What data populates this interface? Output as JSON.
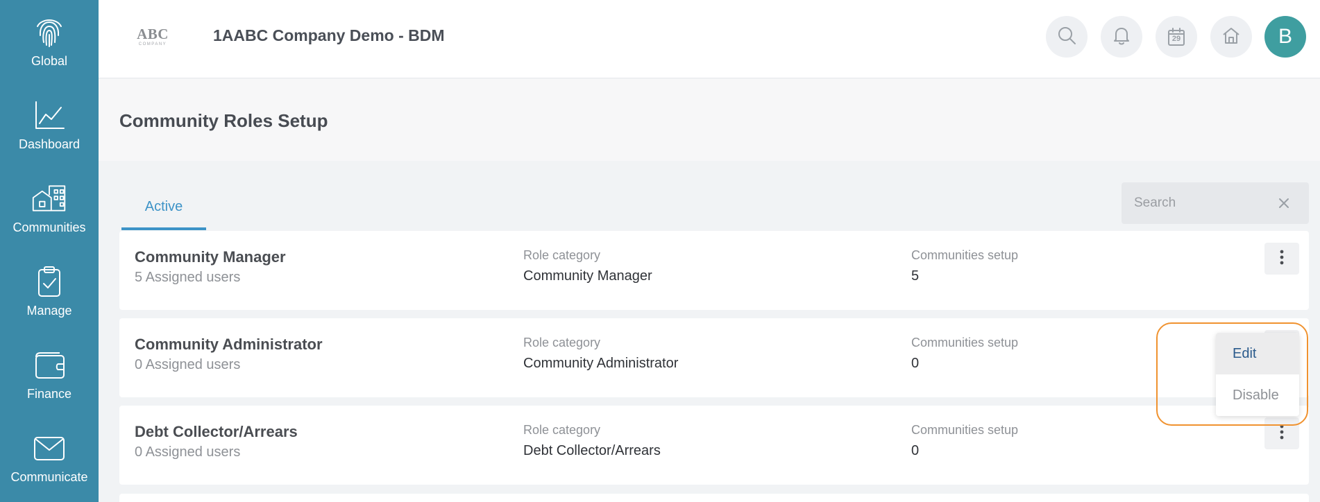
{
  "sidebar": {
    "items": [
      {
        "label": "Global",
        "icon": "fingerprint-icon"
      },
      {
        "label": "Dashboard",
        "icon": "chart-line-icon"
      },
      {
        "label": "Communities",
        "icon": "buildings-icon"
      },
      {
        "label": "Manage",
        "icon": "clipboard-check-icon"
      },
      {
        "label": "Finance",
        "icon": "wallet-icon"
      },
      {
        "label": "Communicate",
        "icon": "envelope-icon"
      }
    ]
  },
  "header": {
    "logo_text": "ABC",
    "logo_subtext": "COMPANY",
    "company_name": "1AABC Company Demo - BDM",
    "calendar_day": "29",
    "avatar_initial": "B"
  },
  "page": {
    "title": "Community Roles Setup"
  },
  "tabs": {
    "active_label": "Active"
  },
  "search": {
    "placeholder": "Search",
    "value": ""
  },
  "roles": [
    {
      "name": "Community Manager",
      "users": "5 Assigned users",
      "category_label": "Role category",
      "category": "Community Manager",
      "communities_label": "Communities setup",
      "communities": "5"
    },
    {
      "name": "Community Administrator",
      "users": "0 Assigned users",
      "category_label": "Role category",
      "category": "Community Administrator",
      "communities_label": "Communities setup",
      "communities": "0"
    },
    {
      "name": "Debt Collector/Arrears",
      "users": "0 Assigned users",
      "category_label": "Role category",
      "category": "Debt Collector/Arrears",
      "communities_label": "Communities setup",
      "communities": "0"
    }
  ],
  "dropdown_menu": {
    "items": [
      "Edit",
      "Disable"
    ]
  },
  "colors": {
    "sidebar": "#3b8aa8",
    "accent": "#3d93c7",
    "avatar": "#3f9ea0",
    "highlight": "#f0922f"
  }
}
